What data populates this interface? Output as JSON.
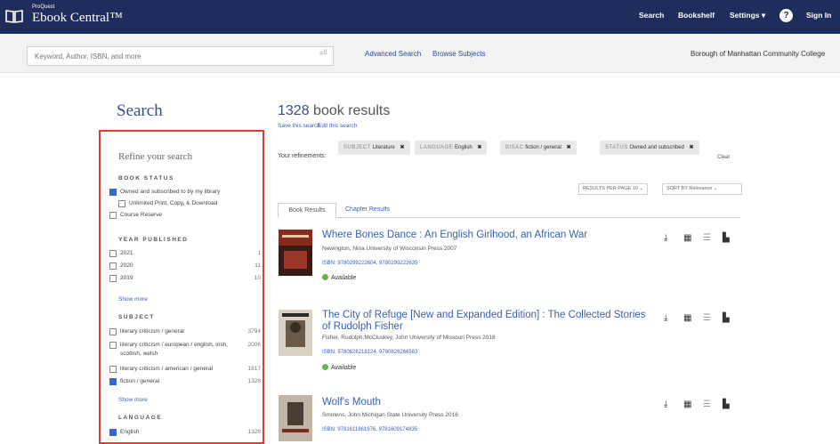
{
  "header": {
    "brand_small": "ProQuest",
    "brand_name": "Ebook Central™",
    "nav": {
      "search": "Search",
      "bookshelf": "Bookshelf",
      "settings": "Settings ▾",
      "help": "?",
      "signin": "Sign In"
    }
  },
  "searchbar": {
    "placeholder": "Keyword, Author, ISBN, and more",
    "go": "⏎",
    "advanced": "Advanced Search",
    "browse": "Browse Subjects",
    "institution": "Borough of Manhattan Community College"
  },
  "sidebar": {
    "heading": "Search",
    "refine": "Refine your search",
    "book_status": {
      "title": "BOOK STATUS",
      "items": [
        {
          "label": "Owned and subscribed to by my library",
          "count": ""
        },
        {
          "label": "Unlimited Print, Copy, & Download",
          "count": ""
        },
        {
          "label": "Course Reserve",
          "count": ""
        }
      ]
    },
    "year": {
      "title": "YEAR PUBLISHED",
      "items": [
        {
          "label": "2021",
          "count": "1"
        },
        {
          "label": "2020",
          "count": "11"
        },
        {
          "label": "2019",
          "count": "10"
        }
      ],
      "show_more": "Show more"
    },
    "subject": {
      "title": "SUBJECT",
      "items": [
        {
          "label": "literary criticism / general",
          "count": "3794"
        },
        {
          "label": "literary criticism / european / english, irish, scottish, welsh",
          "count": "2006"
        },
        {
          "label": "literary criticism / american / general",
          "count": "1817"
        },
        {
          "label": "fiction / general",
          "count": "1328"
        }
      ],
      "show_more": "Show more"
    },
    "language": {
      "title": "LANGUAGE",
      "items": [
        {
          "label": "English",
          "count": "1328"
        }
      ]
    }
  },
  "results": {
    "count": "1328",
    "count_suffix": "book results",
    "save_search": "Save this search",
    "edit_search": "Edit this search",
    "refinements_label": "Your refinements:",
    "chips": [
      {
        "key": "SUBJECT",
        "value": "Literature"
      },
      {
        "key": "LANGUAGE",
        "value": "English"
      },
      {
        "key": "BISAC",
        "value": "fiction / general"
      },
      {
        "key": "STATUS",
        "value": "Owned and subscribed"
      }
    ],
    "chip_close": "✖",
    "clear": "Clear",
    "per_page": "RESULTS PER PAGE  10  ⌄",
    "sort": "SORT BY  Relevance  ⌄",
    "tabs": {
      "books": "Book Results",
      "chapters": "Chapter Results"
    },
    "items": [
      {
        "title": "Where Bones Dance : An English Girlhood, an African War",
        "meta": "Newington, Nina  University of Wisconsin Press  2007",
        "isbn": "ISBN: 9780299222604, 9780299222635",
        "status": "Available"
      },
      {
        "title": "The City of Refuge [New and Expanded Edition] : The Collected Stories of Rudolph Fisher",
        "meta": "Fisher, Rudolph;McCluskey, John  University of Missouri Press  2018",
        "isbn": "ISBN: 9780826218124, 9780826266583",
        "status": "Available"
      },
      {
        "title": "Wolf's Mouth",
        "meta": "Smolens, John  Michigan State University Press  2016",
        "isbn": "ISBN: 9781611861976, 9781609174835",
        "status": ""
      }
    ]
  },
  "colors": {
    "nav_bg": "#1f2d5c",
    "link": "#3a5fb0",
    "highlight_border": "#e53b33",
    "available": "#6ab04c"
  }
}
